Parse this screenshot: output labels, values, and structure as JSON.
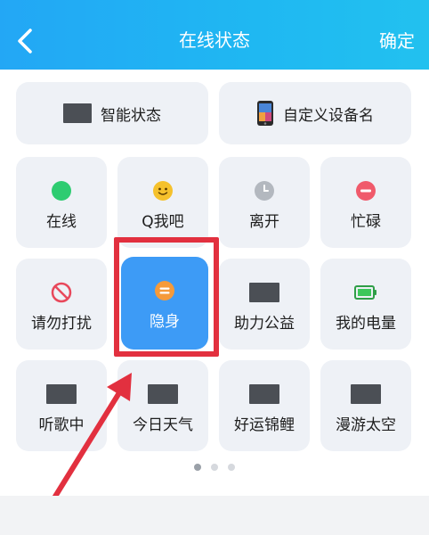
{
  "header": {
    "title": "在线状态",
    "confirm_label": "确定",
    "back_icon": "chevron-left-icon"
  },
  "wide_tiles": [
    {
      "label": "智能状态",
      "icon": "image-placeholder"
    },
    {
      "label": "自定义设备名",
      "icon": "phone-icon"
    }
  ],
  "status_grid": [
    {
      "label": "在线",
      "icon": "green-dot-icon"
    },
    {
      "label": "Q我吧",
      "icon": "smiley-icon"
    },
    {
      "label": "离开",
      "icon": "clock-icon"
    },
    {
      "label": "忙碌",
      "icon": "minus-circle-icon"
    },
    {
      "label": "请勿打扰",
      "icon": "no-entry-icon"
    },
    {
      "label": "隐身",
      "icon": "equals-circle-icon",
      "selected": true
    },
    {
      "label": "助力公益",
      "icon": "image-placeholder"
    },
    {
      "label": "我的电量",
      "icon": "battery-icon"
    },
    {
      "label": "听歌中",
      "icon": "image-placeholder"
    },
    {
      "label": "今日天气",
      "icon": "image-placeholder"
    },
    {
      "label": "好运锦鲤",
      "icon": "image-placeholder"
    },
    {
      "label": "漫游太空",
      "icon": "image-placeholder"
    }
  ],
  "pagination": {
    "current": 1,
    "total": 3
  },
  "colors": {
    "header": "#23a7f5",
    "selected_tile": "#3d9bf6",
    "highlight": "#e2303f"
  }
}
